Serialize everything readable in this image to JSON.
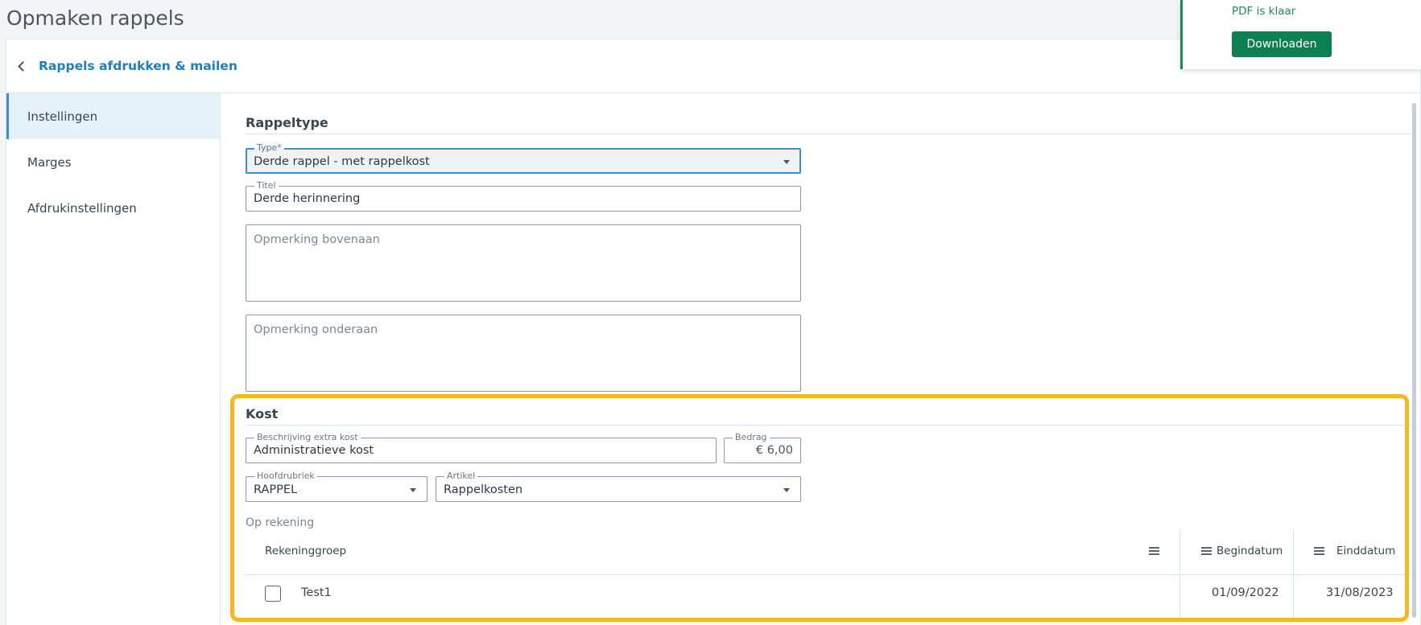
{
  "page": {
    "title": "Opmaken rappels"
  },
  "header": {
    "back_label": "Rappels afdrukken & mailen"
  },
  "sidebar": {
    "items": [
      {
        "label": "Instellingen",
        "active": true
      },
      {
        "label": "Marges",
        "active": false
      },
      {
        "label": "Afdrukinstellingen",
        "active": false
      }
    ]
  },
  "rappeltype": {
    "title": "Rappeltype",
    "type_label": "Type*",
    "type_value": "Derde rappel - met rappelkost",
    "titel_label": "Titel",
    "titel_value": "Derde herinnering",
    "top_note_placeholder": "Opmerking bovenaan",
    "bottom_note_placeholder": "Opmerking onderaan"
  },
  "kost": {
    "title": "Kost",
    "desc_label": "Beschrijving extra kost",
    "desc_value": "Administratieve kost",
    "amount_label": "Bedrag",
    "amount_value": "€ 6,00",
    "hoofdrubriek_label": "Hoofdrubriek",
    "hoofdrubriek_value": "RAPPEL",
    "artikel_label": "Artikel",
    "artikel_value": "Rappelkosten",
    "op_rekening": "Op rekening"
  },
  "table": {
    "headers": {
      "group": "Rekeninggroep",
      "start": "Begindatum",
      "end": "Einddatum"
    },
    "rows": [
      {
        "group": "Test1",
        "start": "01/09/2022",
        "end": "31/08/2023",
        "checked": false
      }
    ]
  },
  "toast": {
    "message": "PDF is klaar",
    "button": "Downloaden"
  },
  "colors": {
    "accent": "#1e7fc0",
    "success": "#0d8050",
    "highlight": "#f4b91e"
  }
}
